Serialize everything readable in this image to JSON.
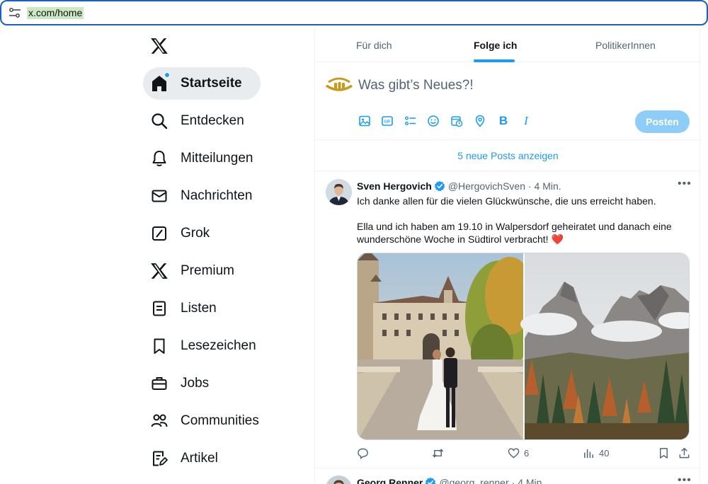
{
  "browser": {
    "url": "x.com/home"
  },
  "sidebar": {
    "items": [
      {
        "label": "Startseite",
        "icon": "home-icon",
        "active": true
      },
      {
        "label": "Entdecken",
        "icon": "search-icon"
      },
      {
        "label": "Mitteilungen",
        "icon": "bell-icon"
      },
      {
        "label": "Nachrichten",
        "icon": "mail-icon"
      },
      {
        "label": "Grok",
        "icon": "grok-icon"
      },
      {
        "label": "Premium",
        "icon": "x-logo-icon"
      },
      {
        "label": "Listen",
        "icon": "list-icon"
      },
      {
        "label": "Lesezeichen",
        "icon": "bookmark-icon"
      },
      {
        "label": "Jobs",
        "icon": "briefcase-icon"
      },
      {
        "label": "Communities",
        "icon": "people-icon"
      },
      {
        "label": "Artikel",
        "icon": "article-icon"
      }
    ]
  },
  "tabs": [
    {
      "label": "Für dich"
    },
    {
      "label": "Folge ich",
      "active": true
    },
    {
      "label": "PolitikerInnen"
    }
  ],
  "compose": {
    "placeholder": "Was gibt’s Neues?!",
    "post_label": "Posten",
    "toolbar": [
      "image-icon",
      "gif-icon",
      "poll-icon",
      "emoji-icon",
      "schedule-icon",
      "location-icon",
      "bold-icon",
      "italic-icon"
    ],
    "bold_label": "B",
    "italic_label": "I"
  },
  "new_posts": "5 neue Posts anzeigen",
  "tweets": [
    {
      "name": "Sven Hergovich",
      "handle": "@HergovichSven",
      "time": "· 4 Min.",
      "lines": [
        "Ich danke allen für die vielen Glückwünsche, die uns erreicht haben.",
        "Ella und ich haben am 19.10 in Walpersdorf geheiratet und danach eine",
        "wunderschöne Woche in Südtirol verbracht! ❤️"
      ],
      "likes": "6",
      "views": "40"
    },
    {
      "name": "Georg Renner",
      "handle": "@georg_renner",
      "time": "· 4 Min."
    }
  ],
  "colors": {
    "accent": "#1d9bf0",
    "post_button": "#8ecdf8",
    "heart": "#e0245e"
  }
}
